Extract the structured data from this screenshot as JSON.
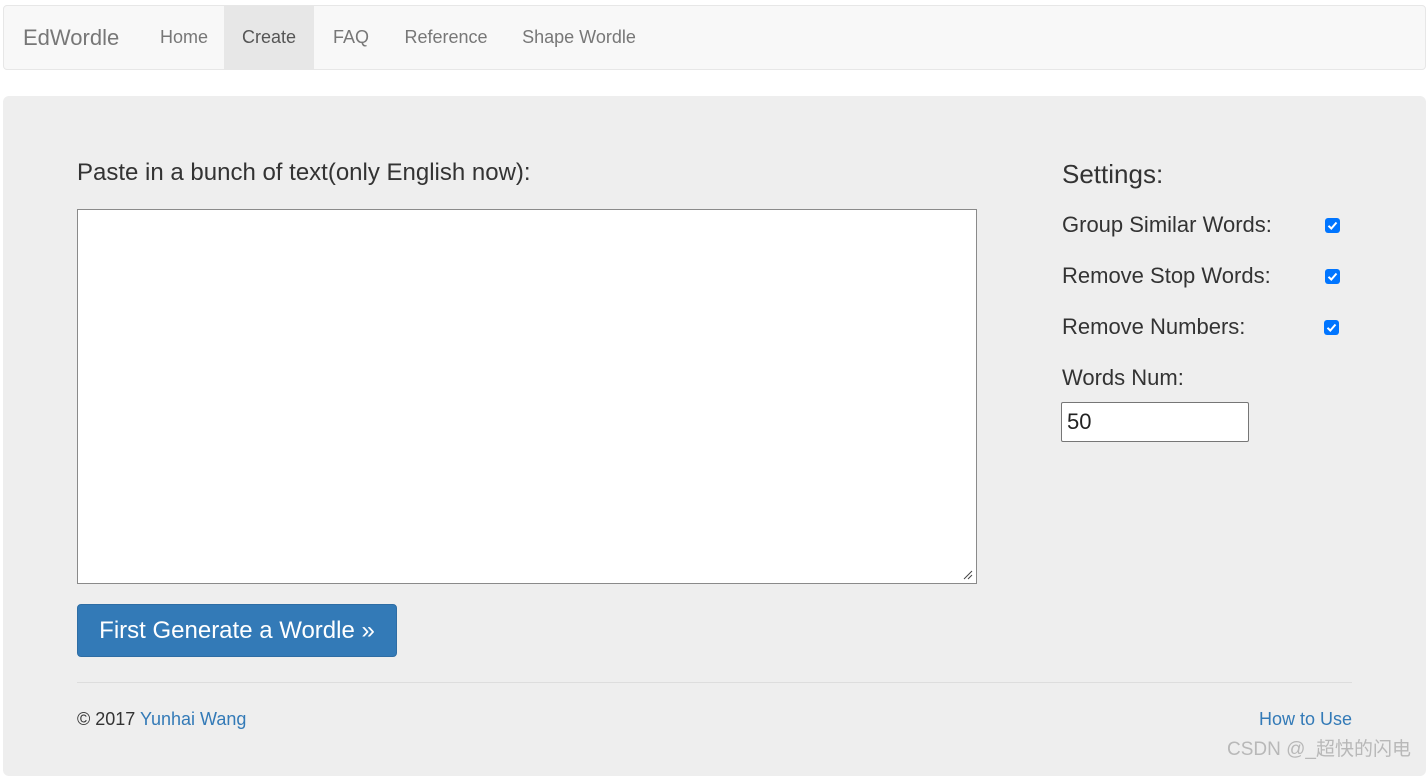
{
  "navbar": {
    "brand": "EdWordle",
    "items": [
      {
        "label": "Home",
        "active": false
      },
      {
        "label": "Create",
        "active": true
      },
      {
        "label": "FAQ",
        "active": false
      },
      {
        "label": "Reference",
        "active": false
      },
      {
        "label": "Shape Wordle",
        "active": false
      }
    ]
  },
  "main": {
    "paste_label": "Paste in a bunch of text(only English now):",
    "text_value": "",
    "generate_button": "First Generate a Wordle »"
  },
  "settings": {
    "title": "Settings:",
    "options": [
      {
        "label": "Group Similar Words:",
        "checked": true
      },
      {
        "label": "Remove Stop Words:",
        "checked": true
      },
      {
        "label": "Remove Numbers:",
        "checked": true
      }
    ],
    "words_num_label": "Words Num:",
    "words_num_value": "50"
  },
  "footer": {
    "copyright": "© 2017 ",
    "author": "Yunhai Wang",
    "how_to_use": "How to Use"
  },
  "watermark": "CSDN @_超快的闪电",
  "colors": {
    "primary": "#337ab7",
    "checkbox": "#0075ff",
    "panel": "#eeeeee"
  }
}
